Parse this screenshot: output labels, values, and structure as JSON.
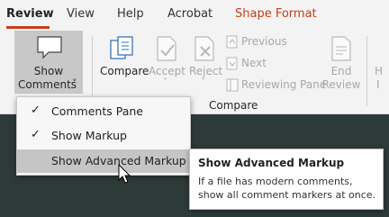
{
  "tabs": [
    "Review",
    "View",
    "Help",
    "Acrobat",
    "Shape Format"
  ],
  "show_comments": {
    "line1": "Show",
    "line2": "Comments",
    "chevron": "˅"
  },
  "compare_group": {
    "compare": "Compare",
    "accept": "Accept",
    "reject": "Reject",
    "previous": "Previous",
    "next": "Next",
    "reviewing_pane": "Reviewing Pane",
    "end_line1": "End",
    "end_line2": "Review",
    "group_label": "Compare"
  },
  "truncated": {
    "h": "H",
    "i": "I"
  },
  "menu": {
    "items": [
      {
        "check": "✓",
        "label": "Comments Pane"
      },
      {
        "check": "✓",
        "label": "Show Markup"
      },
      {
        "check": "",
        "label": "Show Advanced Markup"
      }
    ]
  },
  "tooltip": {
    "title": "Show Advanced Markup",
    "line1": "If a file has modern comments,",
    "line2": "show all comment markers at once."
  },
  "icons": [
    "comment-icon",
    "compare-icon",
    "accept-icon",
    "reject-icon",
    "previous-icon",
    "next-icon",
    "reviewing-pane-icon",
    "end-review-icon",
    "checkmark-icon",
    "mouse-pointer-icon"
  ],
  "colors": {
    "accent": "#c43e1c",
    "ribbon_bg": "#f3f3f3",
    "menu_hover": "#c5c5c5",
    "backdrop": "#2d3b38"
  }
}
